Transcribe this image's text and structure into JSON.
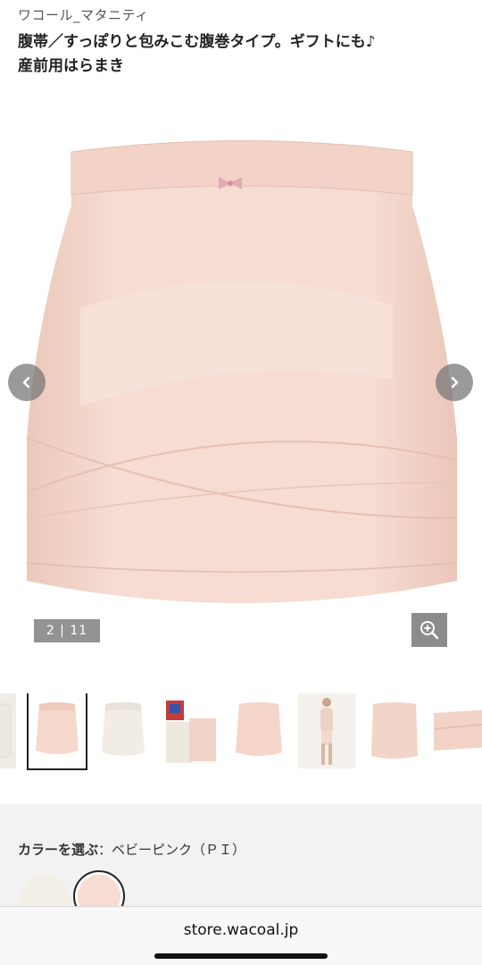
{
  "header": {
    "brand": "ワコール_マタニティ",
    "title_line1": "腹帯／すっぽりと包みこむ腹巻タイプ。ギフトにも♪",
    "title_line2": "産前用はらまき"
  },
  "gallery": {
    "counter": "2 | 11",
    "prev_icon": "chevron-left-icon",
    "next_icon": "chevron-right-icon",
    "zoom_icon": "zoom-in-icon",
    "colors": {
      "pink": "#f6dcd2",
      "pink_shadow": "#ecc8bb",
      "overlay": "#787878"
    }
  },
  "thumbnails": [
    {
      "name": "ivory-side"
    },
    {
      "name": "pink-front",
      "selected": true
    },
    {
      "name": "ivory-front"
    },
    {
      "name": "package"
    },
    {
      "name": "pink-front-2"
    },
    {
      "name": "model"
    },
    {
      "name": "pink-back"
    },
    {
      "name": "fabric-detail"
    }
  ],
  "color_selector": {
    "label": "カラーを選ぶ",
    "separator": "：",
    "value": "ベビーピンク（ＰＩ）",
    "swatches": [
      {
        "name": "ivory",
        "color": "#f1ece4"
      },
      {
        "name": "baby-pink",
        "color": "#f6dcd2",
        "selected": true
      }
    ]
  },
  "browser": {
    "url": "store.wacoal.jp"
  }
}
